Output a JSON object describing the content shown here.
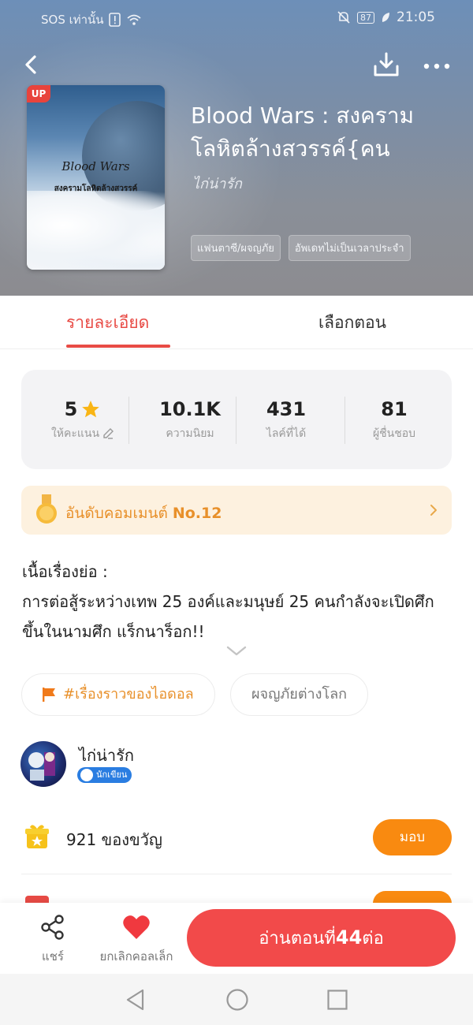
{
  "status_bar": {
    "carrier": "SOS เท่านั้น",
    "battery": "87",
    "time": "21:05"
  },
  "book": {
    "badge": "UP",
    "cover_title": "Blood Wars",
    "cover_subtitle": "สงครามโลหิตล้างสวรรค์",
    "title": "Blood Wars : สงคราม\nโลหิตล้างสวรรค์{คน",
    "author": "ไก่น่ารัก",
    "tags": [
      "แฟนตาซี/ผจญภัย",
      "อัพเดทไม่เป็นเวลาประจำ"
    ]
  },
  "tabs": {
    "detail": "รายละเอียด",
    "chapters": "เลือกตอน"
  },
  "stats": [
    {
      "value": "5",
      "label": "ให้คะแนน"
    },
    {
      "value": "10.1K",
      "label": "ความนิยม"
    },
    {
      "value": "431",
      "label": "ไลค์ที่ได้"
    },
    {
      "value": "81",
      "label": "ผู้ชื่นชอบ"
    }
  ],
  "rank": {
    "label": "อันดับคอมเมนต์",
    "value": "No.12"
  },
  "synopsis": {
    "heading": "เนื้อเรื่องย่อ :",
    "body": "การต่อสู้ระหว่างเทพ 25 องค์และมนุษย์ 25 คนกำลังจะเปิดศึกขึ้นในนามศึก แร็กนาร็อก!!"
  },
  "genre_tags": [
    "#เรื่องราวของไอดอล",
    "ผจญภัยต่างโลก"
  ],
  "writer": {
    "name": "ไก่น่ารัก",
    "badge": "นักเขียน"
  },
  "gifts": {
    "count_text": "921 ของขวัญ",
    "button": "มอบ"
  },
  "bottom_bar": {
    "share_label": "แชร์",
    "favorite_label": "ยกเลิกคอลเล็ก",
    "read_prefix": "อ่านตอนที่",
    "read_number": "44",
    "read_suffix": "ต่อ"
  },
  "colors": {
    "accent": "#e84b45",
    "orange": "#f98a10",
    "rank_text": "#e8902a",
    "read_button": "#f24a4a"
  }
}
